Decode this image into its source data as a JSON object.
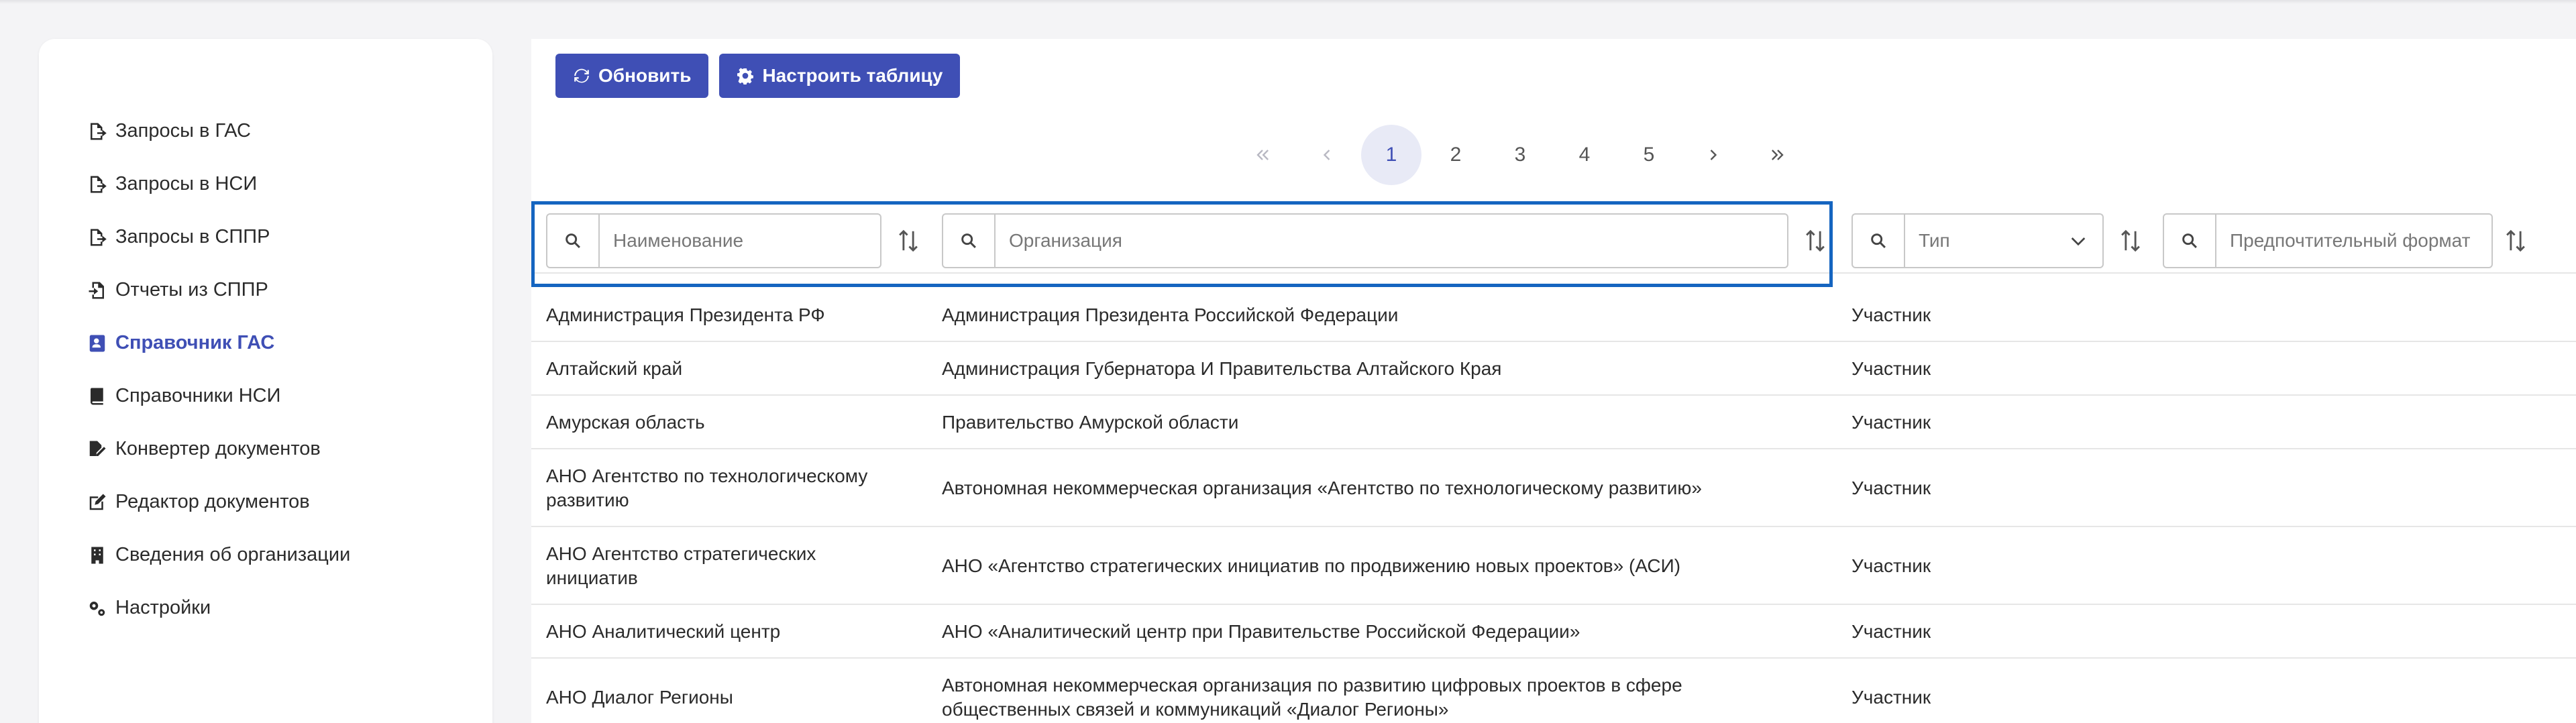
{
  "sidebar": {
    "items": [
      {
        "label": "Запросы в ГАС",
        "icon": "file-export-icon",
        "active": false
      },
      {
        "label": "Запросы в НСИ",
        "icon": "file-export-icon",
        "active": false
      },
      {
        "label": "Запросы в СППР",
        "icon": "file-export-icon",
        "active": false
      },
      {
        "label": "Отчеты из СППР",
        "icon": "file-import-icon",
        "active": false
      },
      {
        "label": "Справочник ГАС",
        "icon": "address-card-icon",
        "active": true
      },
      {
        "label": "Справочники НСИ",
        "icon": "book-icon",
        "active": false
      },
      {
        "label": "Конвертер документов",
        "icon": "file-signature-icon",
        "active": false
      },
      {
        "label": "Редактор документов",
        "icon": "edit-icon",
        "active": false
      },
      {
        "label": "Сведения об организации",
        "icon": "building-icon",
        "active": false
      },
      {
        "label": "Настройки",
        "icon": "cogs-icon",
        "active": false
      }
    ]
  },
  "toolbar": {
    "refresh_label": "Обновить",
    "configure_label": "Настроить таблицу"
  },
  "pagination": {
    "pages": [
      "1",
      "2",
      "3",
      "4",
      "5"
    ],
    "current": "1"
  },
  "filters": {
    "name_placeholder": "Наименование",
    "org_placeholder": "Организация",
    "type_placeholder": "Тип",
    "format_placeholder": "Предпочтительный формат"
  },
  "rows": [
    {
      "name": "Администрация Президента РФ",
      "org": "Администрация Президента Российской Федерации",
      "type": "Участник"
    },
    {
      "name": "Алтайский край",
      "org": "Администрация Губернатора И Правительства Алтайского Края",
      "type": "Участник"
    },
    {
      "name": "Амурская область",
      "org": "Правительство Амурской области",
      "type": "Участник"
    },
    {
      "name": "АНО Агентство по технологическому развитию",
      "org": "Автономная некоммерческая организация «Агентство по технологическому развитию»",
      "type": "Участник"
    },
    {
      "name": "АНО Агентство стратегических инициатив",
      "org": "АНО «Агентство стратегических инициатив по продвижению новых проектов» (АСИ)",
      "type": "Участник"
    },
    {
      "name": "АНО Аналитический центр",
      "org": "АНО «Аналитический центр при Правительстве Российской Федерации»",
      "type": "Участник"
    },
    {
      "name": "АНО Диалог Регионы",
      "org": "Автономная некоммерческая организация по развитию цифровых проектов в сфере общественных связей и коммуникаций «Диалог Регионы»",
      "type": "Участник"
    }
  ],
  "colors": {
    "accent": "#3f4fb5",
    "highlight_border": "#1565c0",
    "active_page_bg": "#e8eaf6"
  }
}
